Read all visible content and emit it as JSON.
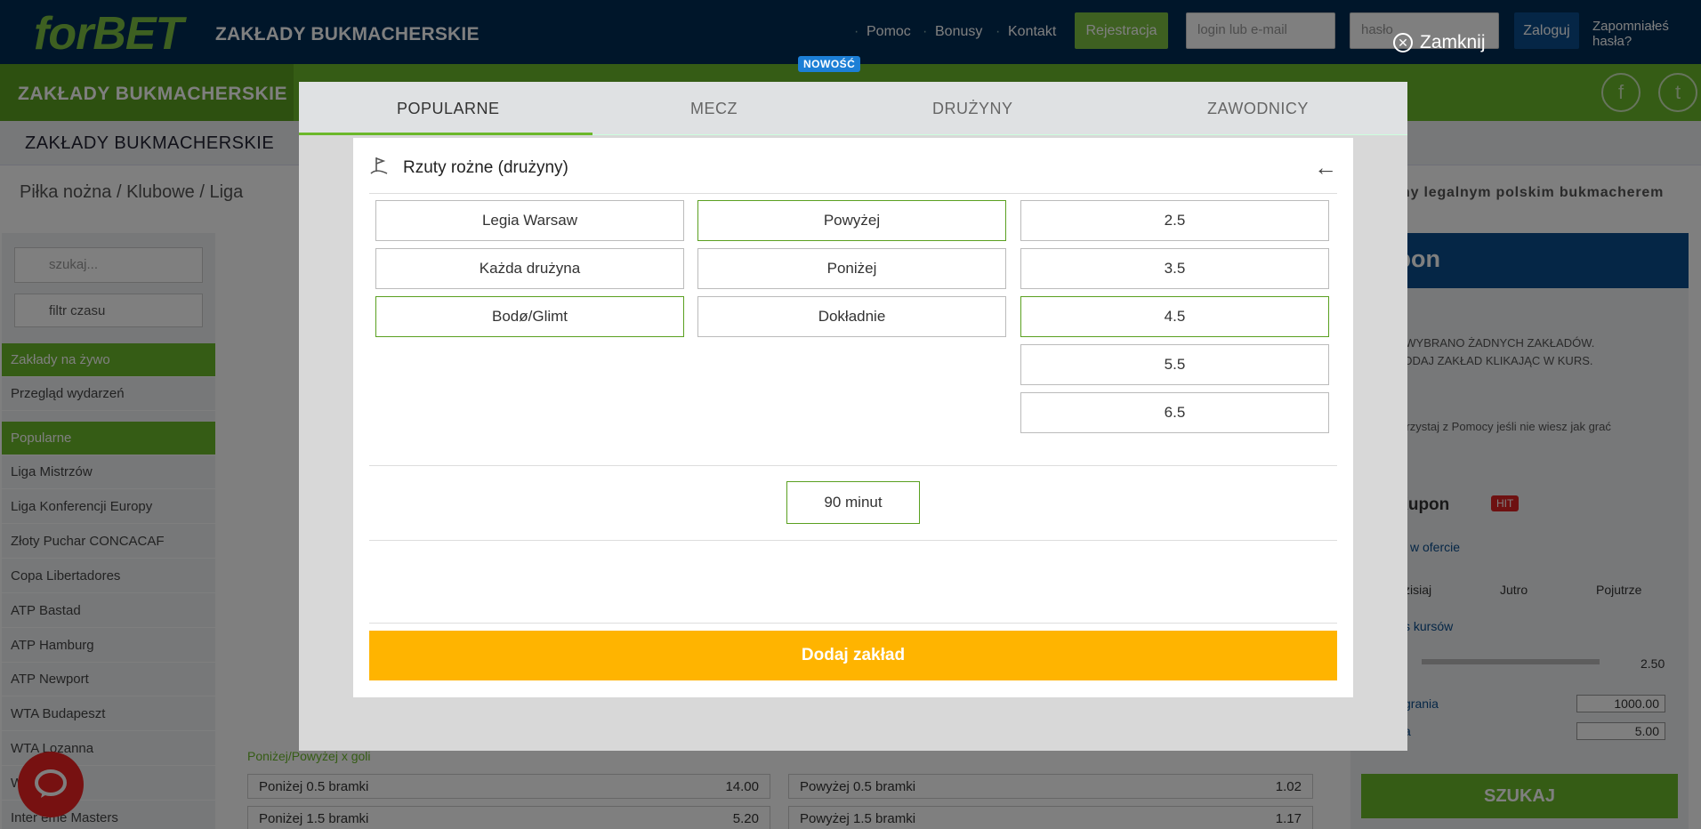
{
  "header": {
    "logo": "forBET",
    "title": "ZAKŁADY BUKMACHERSKIE",
    "nav": [
      "Pomoc",
      "Bonusy",
      "Kontakt"
    ],
    "register": "Rejestracja",
    "login_placeholder": "login lub e-mail",
    "password_placeholder": "hasło",
    "login_button": "Zaloguj",
    "forgot": "Zapomniałeś hasła?"
  },
  "greenbar": {
    "home": "ZAKŁADY BUKMACHERSKIE",
    "badge": "NOWOŚĆ"
  },
  "subbar": {
    "title": "ZAKŁADY BUKMACHERSKIE"
  },
  "breadcrumb": "Piłka nożna / Klubowe / Liga",
  "slogan": "ny legalnym polskim bukmacherem",
  "sidebar": {
    "search_placeholder": "szukaj...",
    "filter": "filtr czasu",
    "items": [
      {
        "label": "Zakłady na żywo",
        "active": true
      },
      {
        "label": "Przegląd wydarzeń",
        "active": false
      },
      {
        "label": "Popularne",
        "active": true
      },
      {
        "label": "Liga Mistrzów",
        "active": false
      },
      {
        "label": "Liga Konferencji Europy",
        "active": false
      },
      {
        "label": "Złoty Puchar CONCACAF",
        "active": false
      },
      {
        "label": "Copa Libertadores",
        "active": false
      },
      {
        "label": "ATP Bastad",
        "active": false
      },
      {
        "label": "ATP Hamburg",
        "active": false
      },
      {
        "label": "ATP Newport",
        "active": false
      },
      {
        "label": "WTA Budapeszt",
        "active": false
      },
      {
        "label": "WTA Lozanna",
        "active": false
      },
      {
        "label": "W",
        "active": false
      },
      {
        "label": "Inter   eme Masters",
        "active": false
      }
    ]
  },
  "main": {
    "bets": [
      {
        "label": "Poniżej 0.5 bramki",
        "odd": "14.00"
      },
      {
        "label": "Powyżej 0.5 bramki",
        "odd": "1.02"
      },
      {
        "label": "Poniżej 1.5 bramki",
        "odd": "5.20"
      },
      {
        "label": "Powyżej 1.5 bramki",
        "odd": "1.17"
      }
    ],
    "bets_header": "Poniżej/Powyżej x goli"
  },
  "coupon": {
    "title": "kupon",
    "empty1": "NIE WYBRANO ŻADNYCH ZAKŁADÓW.",
    "empty2": "DODAJ ZAKŁAD KLIKAJĄC W KURS.",
    "help": "Skorzystaj z Pomocy jeśli nie wiesz jak grać",
    "quick": "ki Kupon",
    "hit": "HIT",
    "offer": "j w ofercie",
    "days": [
      "zisiaj",
      "Jutro",
      "Pojutrze"
    ],
    "odds_label": "s kursów",
    "odds_max": "2.50",
    "win_label": "grania",
    "win_value": "1000.00",
    "stake_label": "a",
    "stake_value": "5.00",
    "search": "SZUKAJ"
  },
  "overlay": {
    "close": "Zamknij",
    "tabs": [
      "POPULARNE",
      "MECZ",
      "DRUŻYNY",
      "ZAWODNICY"
    ],
    "active_tab": "POPULARNE"
  },
  "modal": {
    "title": "Rzuty rożne (drużyny)",
    "icon": "corner-flag-icon",
    "col1": [
      {
        "label": "Legia Warsaw",
        "selected": false
      },
      {
        "label": "Każda drużyna",
        "selected": false
      },
      {
        "label": "Bodø/Glimt",
        "selected": true
      }
    ],
    "col2": [
      {
        "label": "Powyżej",
        "selected": true
      },
      {
        "label": "Poniżej",
        "selected": false
      },
      {
        "label": "Dokładnie",
        "selected": false
      }
    ],
    "col3": [
      {
        "label": "2.5",
        "selected": false
      },
      {
        "label": "3.5",
        "selected": false
      },
      {
        "label": "4.5",
        "selected": true
      },
      {
        "label": "5.5",
        "selected": false
      },
      {
        "label": "6.5",
        "selected": false
      }
    ],
    "duration": "90 minut",
    "add_button": "Dodaj zakład"
  }
}
